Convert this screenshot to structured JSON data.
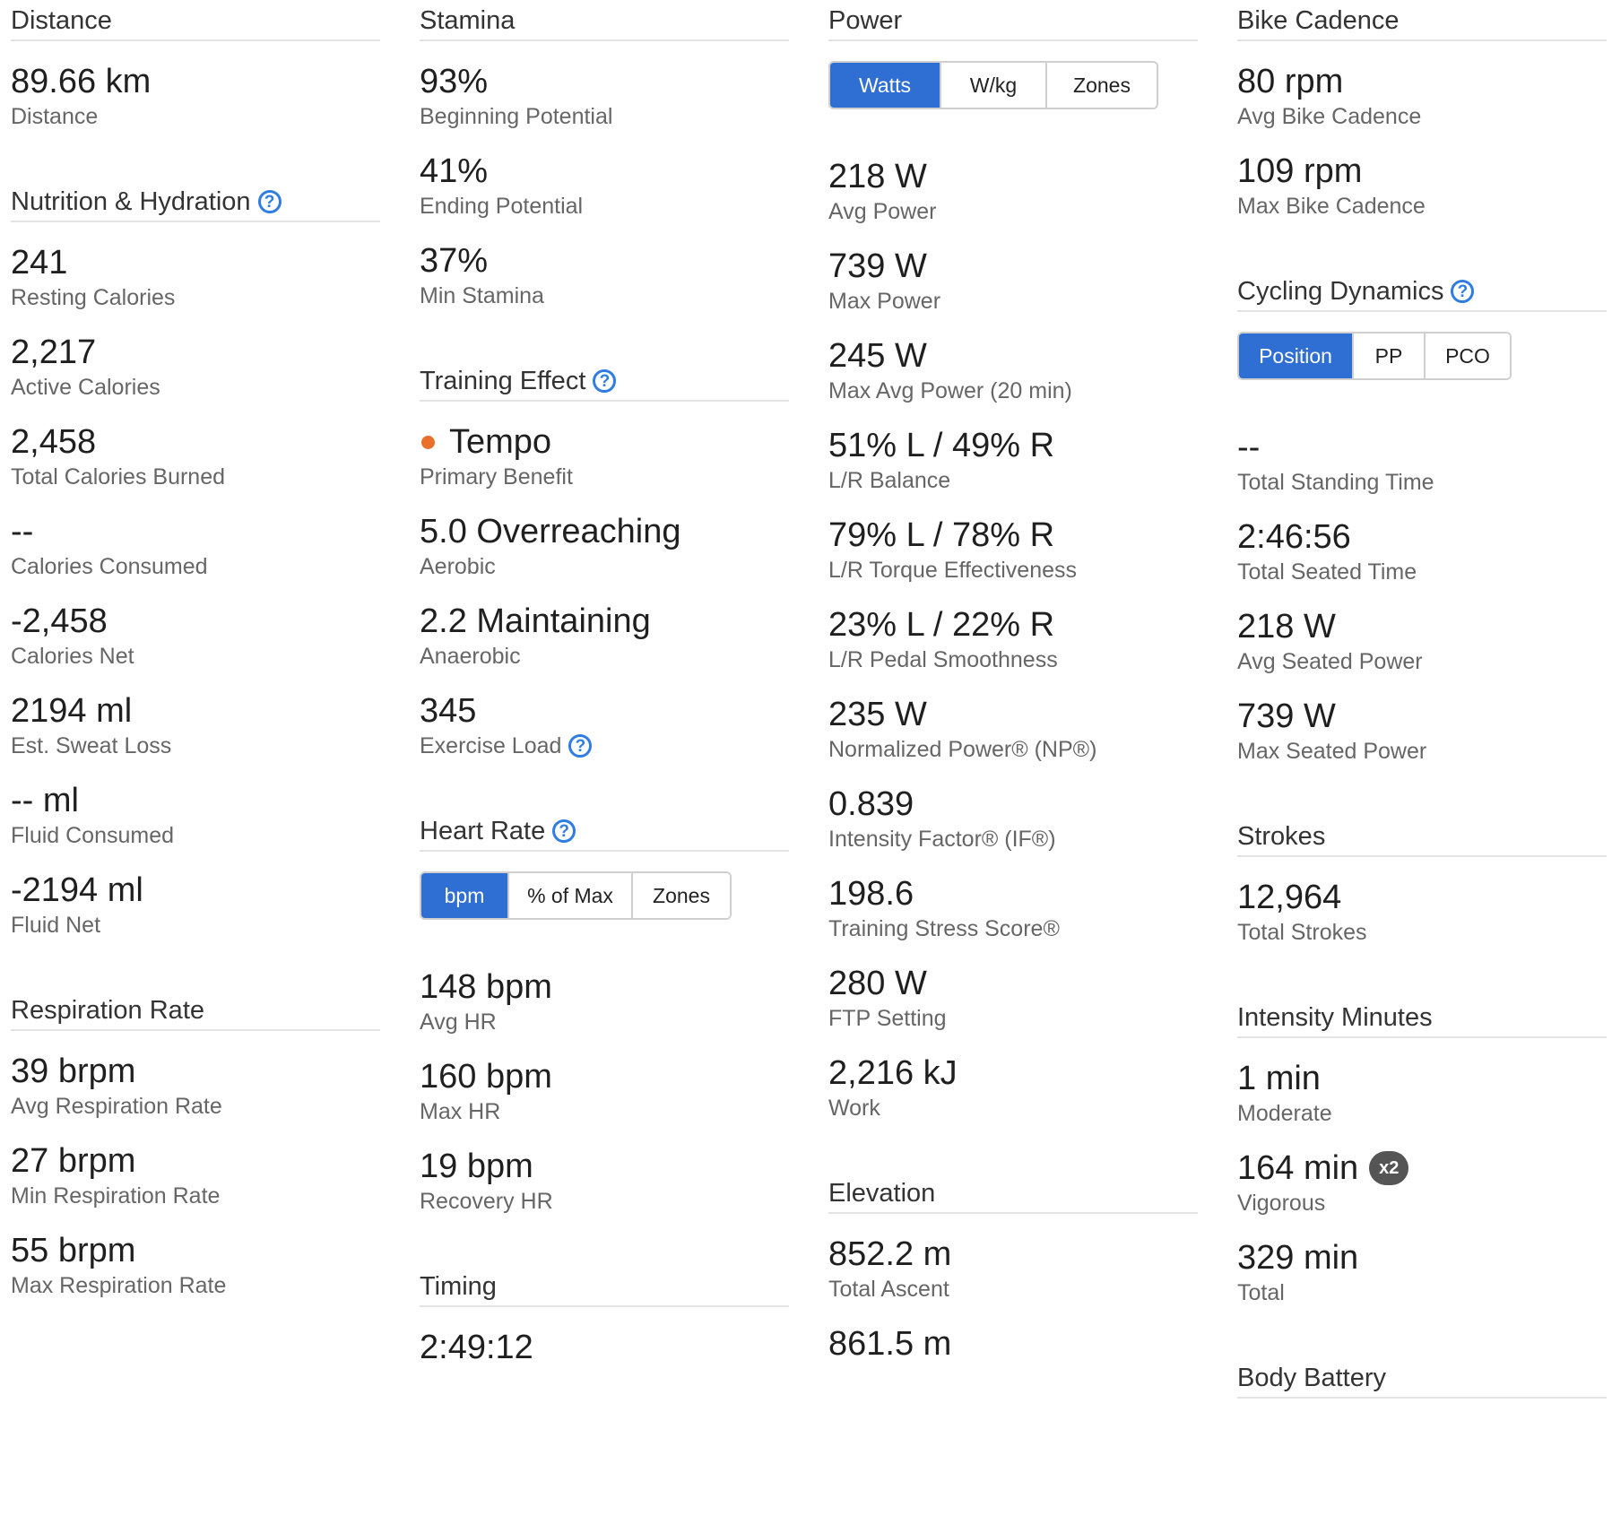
{
  "col1": {
    "distance": {
      "title": "Distance",
      "value": "89.66 km",
      "label": "Distance"
    },
    "nutrition": {
      "title": "Nutrition & Hydration",
      "items": [
        {
          "value": "241",
          "label": "Resting Calories"
        },
        {
          "value": "2,217",
          "label": "Active Calories"
        },
        {
          "value": "2,458",
          "label": "Total Calories Burned"
        },
        {
          "value": "--",
          "label": "Calories Consumed"
        },
        {
          "value": "-2,458",
          "label": "Calories Net"
        },
        {
          "value": "2194 ml",
          "label": "Est. Sweat Loss"
        },
        {
          "value": "-- ml",
          "label": "Fluid Consumed"
        },
        {
          "value": "-2194 ml",
          "label": "Fluid Net"
        }
      ]
    },
    "respiration": {
      "title": "Respiration Rate",
      "items": [
        {
          "value": "39 brpm",
          "label": "Avg Respiration Rate"
        },
        {
          "value": "27 brpm",
          "label": "Min Respiration Rate"
        },
        {
          "value": "55 brpm",
          "label": "Max Respiration Rate"
        }
      ]
    }
  },
  "col2": {
    "stamina": {
      "title": "Stamina",
      "items": [
        {
          "value": "93%",
          "label": "Beginning Potential"
        },
        {
          "value": "41%",
          "label": "Ending Potential"
        },
        {
          "value": "37%",
          "label": "Min Stamina"
        }
      ]
    },
    "training": {
      "title": "Training Effect",
      "primary": {
        "value": "Tempo",
        "label": "Primary Benefit"
      },
      "aerobic": {
        "value": "5.0 Overreaching",
        "label": "Aerobic"
      },
      "anaerobic": {
        "value": "2.2 Maintaining",
        "label": "Anaerobic"
      },
      "load": {
        "value": "345",
        "label": "Exercise Load"
      }
    },
    "hr": {
      "title": "Heart Rate",
      "tabs": [
        "bpm",
        "% of Max",
        "Zones"
      ],
      "items": [
        {
          "value": "148 bpm",
          "label": "Avg HR"
        },
        {
          "value": "160 bpm",
          "label": "Max HR"
        },
        {
          "value": "19 bpm",
          "label": "Recovery HR"
        }
      ]
    },
    "timing": {
      "title": "Timing",
      "first_value": "2:49:12"
    }
  },
  "col3": {
    "power": {
      "title": "Power",
      "tabs": [
        "Watts",
        "W/kg",
        "Zones"
      ],
      "items": [
        {
          "value": "218 W",
          "label": "Avg Power"
        },
        {
          "value": "739 W",
          "label": "Max Power"
        },
        {
          "value": "245 W",
          "label": "Max Avg Power (20 min)"
        },
        {
          "value": "51% L / 49% R",
          "label": "L/R Balance"
        },
        {
          "value": "79% L / 78% R",
          "label": "L/R Torque Effectiveness"
        },
        {
          "value": "23% L / 22% R",
          "label": "L/R Pedal Smoothness"
        },
        {
          "value": "235 W",
          "label": "Normalized Power® (NP®)"
        },
        {
          "value": "0.839",
          "label": "Intensity Factor® (IF®)"
        },
        {
          "value": "198.6",
          "label": "Training Stress Score®"
        },
        {
          "value": "280 W",
          "label": "FTP Setting"
        },
        {
          "value": "2,216 kJ",
          "label": "Work"
        }
      ]
    },
    "elevation": {
      "title": "Elevation",
      "items": [
        {
          "value": "852.2 m",
          "label": "Total Ascent"
        }
      ],
      "next_value": "861.5 m"
    }
  },
  "col4": {
    "cadence": {
      "title": "Bike Cadence",
      "items": [
        {
          "value": "80 rpm",
          "label": "Avg Bike Cadence"
        },
        {
          "value": "109 rpm",
          "label": "Max Bike Cadence"
        }
      ]
    },
    "dynamics": {
      "title": "Cycling Dynamics",
      "tabs": [
        "Position",
        "PP",
        "PCO"
      ],
      "items": [
        {
          "value": "--",
          "label": "Total Standing Time"
        },
        {
          "value": "2:46:56",
          "label": "Total Seated Time"
        },
        {
          "value": "218 W",
          "label": "Avg Seated Power"
        },
        {
          "value": "739 W",
          "label": "Max Seated Power"
        }
      ]
    },
    "strokes": {
      "title": "Strokes",
      "value": "12,964",
      "label": "Total Strokes"
    },
    "intensity": {
      "title": "Intensity Minutes",
      "moderate": {
        "value": "1 min",
        "label": "Moderate"
      },
      "vigorous": {
        "value": "164 min",
        "label": "Vigorous",
        "badge": "x2"
      },
      "total": {
        "value": "329 min",
        "label": "Total"
      }
    },
    "next_title": "Body Battery"
  },
  "colors": {
    "accent": "#2f6fd3",
    "help": "#2f7de1",
    "dot": "#e8702a",
    "badge": "#555555"
  }
}
